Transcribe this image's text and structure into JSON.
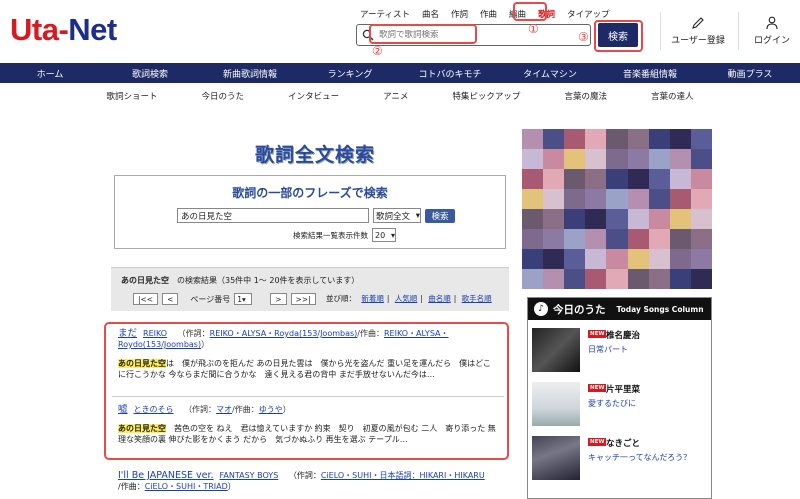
{
  "logo": {
    "part1": "Uta-",
    "part2": "Net"
  },
  "search_types": [
    {
      "label": "アーティスト",
      "selected": false
    },
    {
      "label": "曲名",
      "selected": false
    },
    {
      "label": "作詞",
      "selected": false
    },
    {
      "label": "作曲",
      "selected": false
    },
    {
      "label": "編曲",
      "selected": false
    },
    {
      "label": "歌詞",
      "selected": true
    },
    {
      "label": "タイアップ",
      "selected": false
    }
  ],
  "search": {
    "placeholder": "歌詞で歌詞検索",
    "button_label": "検索"
  },
  "annotations": {
    "one": "①",
    "two": "②",
    "three": "③"
  },
  "header_actions": {
    "user_register": "ユーザー登録",
    "login": "ログイン"
  },
  "nav": [
    "ホーム",
    "歌詞検索",
    "新曲歌詞情報",
    "ランキング",
    "コトバのキモチ",
    "タイムマシン",
    "音楽番組情報",
    "動画プラス"
  ],
  "subnav": [
    "歌詞ショート",
    "今日のうた",
    "インタビュー",
    "アニメ",
    "特集ピックアップ",
    "言葉の魔法",
    "言葉の達人"
  ],
  "page_title": "歌詞全文検索",
  "phrase_search": {
    "title": "歌詞の一部のフレーズで検索",
    "query": "あの日見た空",
    "mode": "歌詞全文",
    "button": "検索",
    "per_page_label": "検索結果一覧表示件数",
    "per_page": "20"
  },
  "results_info": {
    "query": "あの日見た空",
    "summary": "の検索結果（35件中 1〜 20件を表示しています）",
    "first": "|<<",
    "prev": "<",
    "page_label": "ページ番号",
    "page": "1",
    "next": ">",
    "last": ">>|",
    "sort_label": "並び順：",
    "sort_options": [
      "新着順",
      "人気順",
      "曲名順",
      "歌手名順"
    ]
  },
  "results": [
    {
      "title": "まだ",
      "artist": "REIKO",
      "credit_prefix": "（作詞：",
      "lyricist": "REIKO・ALYSA・Royda(153/Joombas)",
      "composer_prefix": "/作曲：",
      "composer_a": "REIKO・ALYSA・",
      "composer_b": "Roydo(153/Joombas)",
      "credit_suffix": "）",
      "highlight": "あの日見た空",
      "snippet": "は　僕が飛ぶのを拒んだ あの日見た雲は　僕から光を盗んだ 重い足を運んだら　僕はどこに行こうかな 今ならまだ間に合うかな　遠く見える君の背中 まだ手放せないんだ今は…"
    },
    {
      "title": "嘘",
      "artist": "ときのそら",
      "credit_prefix": "（作詞：",
      "lyricist": "マオ",
      "composer_prefix": "/作曲：",
      "composer_a": "ゆうや",
      "composer_b": "",
      "credit_suffix": "）",
      "highlight": "あの日見た空",
      "snippet": "　茜色の空を ねえ　君は憶えていますか 約束　契り　初夏の風が包む 二人　寄り添った 無理な笑顔の裏 伸びた影をかくまう だから　気づかぬふり 再生を選ぶ テープル…"
    },
    {
      "title": "I'll Be JAPANESE ver.",
      "artist": "FANTASY BOYS",
      "credit_prefix": "（作詞：",
      "lyricist": "CiELO・SUHI・日本語詞：HIKARI・HIKARU",
      "composer_prefix": "/作曲：",
      "composer_a": "CiELO・SUHI・TRIAD",
      "composer_b": "",
      "credit_suffix": "）"
    }
  ],
  "today_song": {
    "title": "今日のうた",
    "subtitle": "Today Songs Column",
    "new_badge": "NEW",
    "items": [
      {
        "artist": "椎名慶治",
        "song": "日常パート"
      },
      {
        "artist": "片平里菜",
        "song": "愛するたびに"
      },
      {
        "artist": "なきごと",
        "song": "キャッチ一ってなんだろう？"
      }
    ]
  }
}
